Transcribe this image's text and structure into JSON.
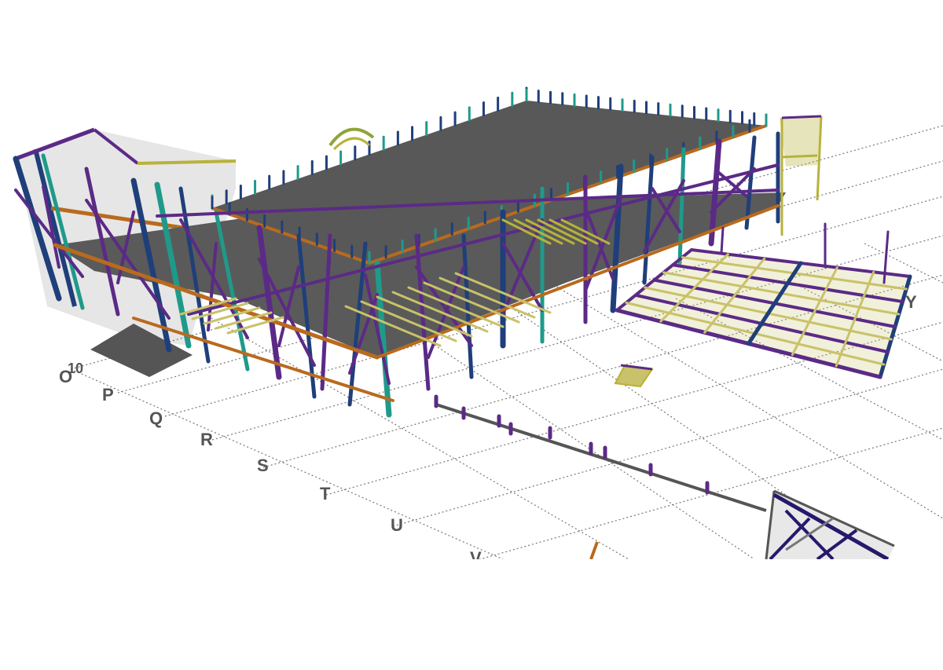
{
  "viewport": {
    "background": "#ffffff",
    "palette": {
      "grid_line": "#777777",
      "slab": "#5a5a5a",
      "slab_dark": "#444444",
      "column_blue": "#1f3f7a",
      "brace_purple": "#5b2a86",
      "beam_teal": "#1f9a8a",
      "beam_yellow": "#b8b23a",
      "beam_orange": "#b96a1e",
      "beam_red": "#b02020",
      "deck_truss": "#c9c26a",
      "label": "#555555"
    },
    "grid_labels": {
      "row_letters": [
        "O",
        "P",
        "Q",
        "R",
        "S",
        "T",
        "U",
        "V"
      ],
      "column_number": "10",
      "far_letter_y": "Y"
    },
    "elements": {
      "main_building": "main-steel-building",
      "roof_slab": "roof-slab",
      "floor_slab": "floor-slab",
      "wing_truss": "left-wing-truss",
      "floor_truss_frame": "right-floor-truss-frame",
      "foundation_beam": "ground-foundation-beam",
      "small_frame": "small-truss-piece",
      "corner_truss": "bottom-right-truss"
    }
  }
}
